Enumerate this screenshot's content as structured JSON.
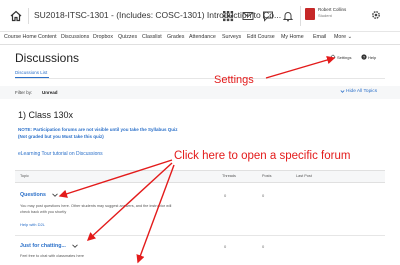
{
  "topbar": {
    "course_title": "SU2018-ITSC-1301 - (Includes: COSC-1301) Introduction to Co...",
    "user_name": "Robert Collins",
    "user_role": "Student",
    "icons": [
      "home-icon",
      "apps-grid-icon",
      "mail-icon",
      "chat-icon",
      "bell-icon",
      "settings-icon"
    ]
  },
  "navbar": {
    "items": [
      "Course Home",
      "Content",
      "Discussions",
      "Dropbox",
      "Quizzes",
      "Classlist",
      "Grades",
      "Attendance",
      "Surveys",
      "Edit Course",
      "My Home",
      "Email",
      "More"
    ]
  },
  "page": {
    "title": "Discussions",
    "settings_label": "Settings",
    "help_label": "Help",
    "tab_label": "Discussions List",
    "filter_label": "Filter by:",
    "filter_value": "Unread",
    "hide_all_label": "Hide All Topics"
  },
  "section": {
    "title": "1) Class 130x",
    "note_line1": "NOTE: Participation forums are not visible until you take the Syllabus Quiz",
    "note_line2": "(Not graded but you Must take this quiz)",
    "tour_link": "eLearning Tour tutorial on Discussions"
  },
  "table": {
    "headers": [
      "Topic",
      "Threads",
      "Posts",
      "Last Post"
    ],
    "rows": [
      {
        "title": "Questions",
        "desc1": "You may post questions here. Other students may suggest answers, and the instructor will",
        "desc2": "check back with you shortly",
        "help_link": "Help with D2L",
        "threads": "0",
        "posts": "0"
      },
      {
        "title": "Just for chatting...",
        "desc1": "Feel free to chat with classmates here",
        "threads": "0",
        "posts": "0"
      }
    ]
  },
  "annotations": {
    "settings": "Settings",
    "forum": "Click here to open a specific forum"
  },
  "colors": {
    "accent": "#2b70c9",
    "annotation": "#e31b1b",
    "avatar": "#c62828"
  }
}
